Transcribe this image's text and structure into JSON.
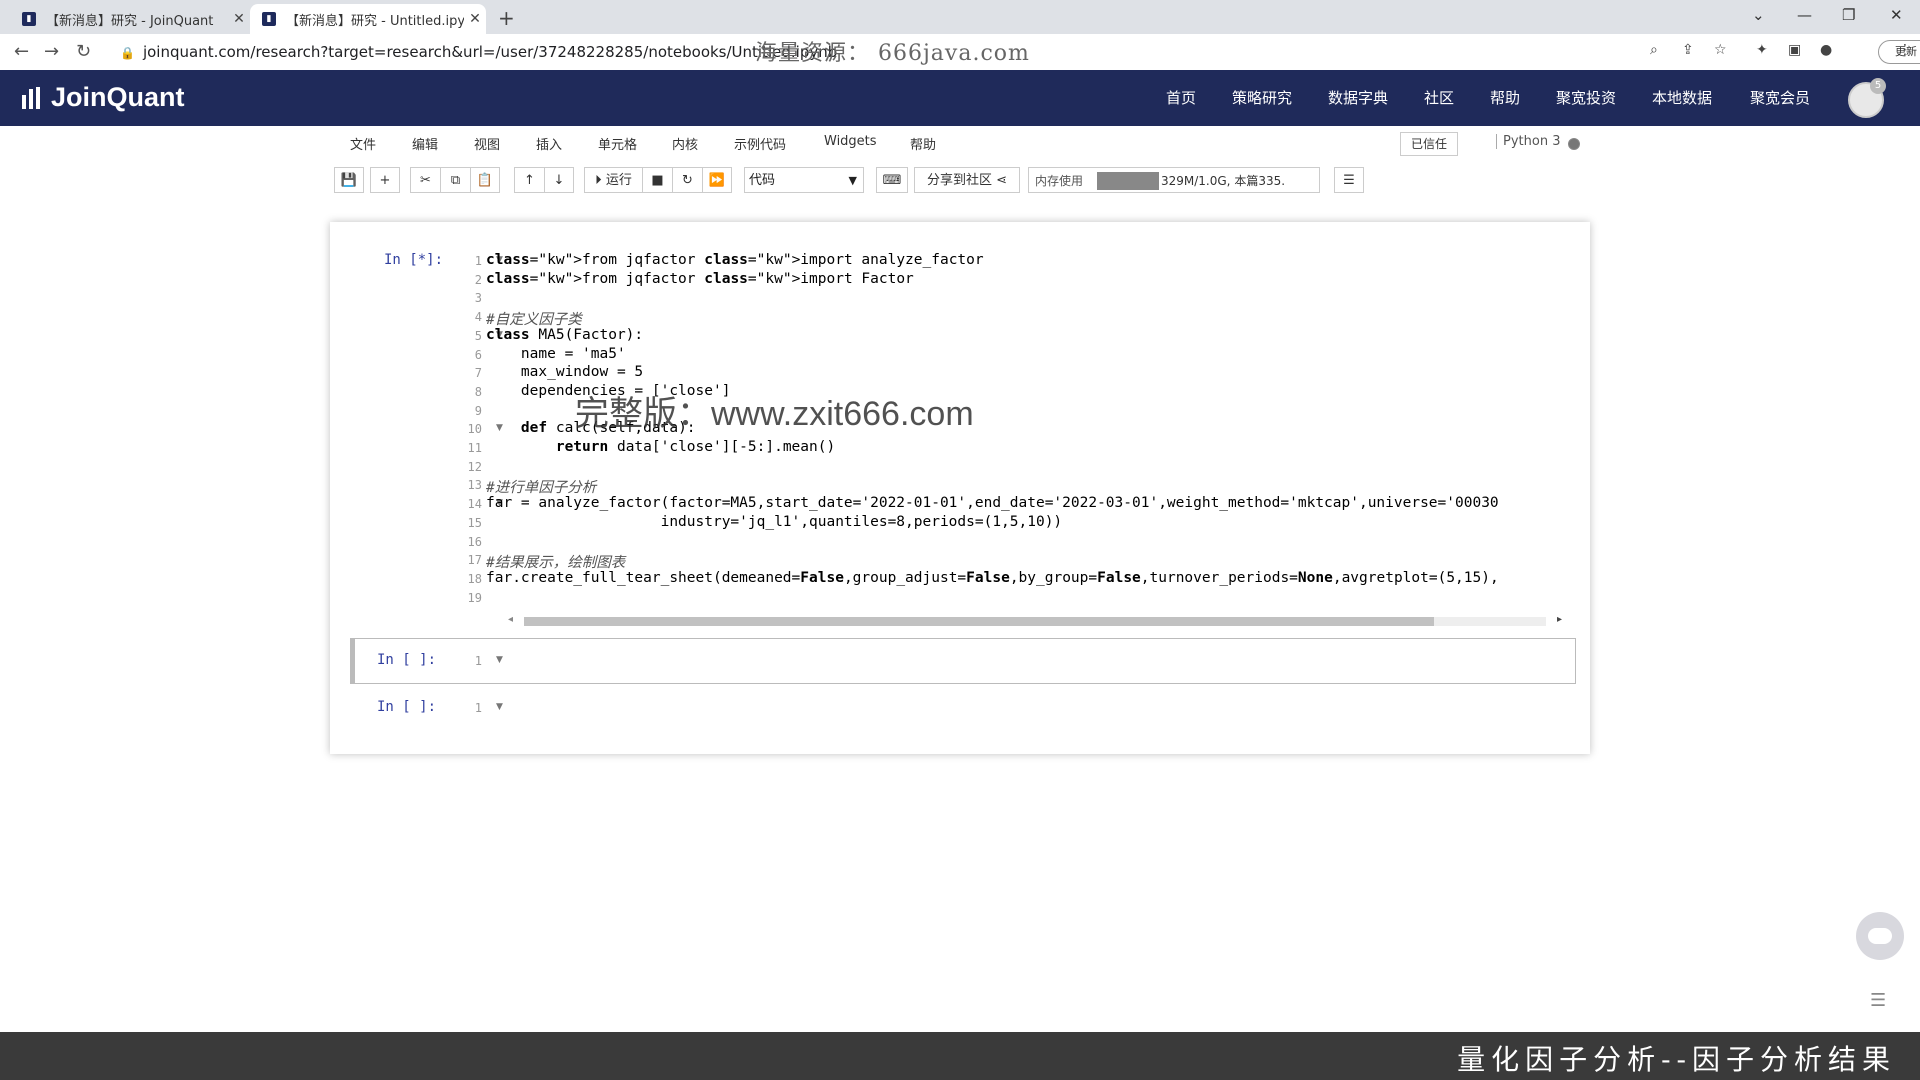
{
  "browser": {
    "tabs": [
      {
        "title": "【新消息】研究 - JoinQuant",
        "active": false
      },
      {
        "title": "【新消息】研究 - Untitled.ipyn",
        "active": true
      }
    ],
    "url": "joinquant.com/research?target=research&url=/user/37248228285/notebooks/Untitled.ipynb",
    "overlay_watermark": "海量资源： 666java.com",
    "update_label": "更新"
  },
  "header": {
    "logo": "JoinQuant",
    "nav": [
      "首页",
      "策略研究",
      "数据字典",
      "社区",
      "帮助",
      "聚宽投资",
      "本地数据",
      "聚宽会员"
    ],
    "notification_count": "5"
  },
  "jupyter_menu": {
    "items": [
      "文件",
      "编辑",
      "视图",
      "插入",
      "单元格",
      "内核",
      "示例代码",
      "Widgets",
      "帮助"
    ],
    "trusted": "已信任",
    "kernel": "Python 3"
  },
  "toolbar": {
    "run_label": "运行",
    "cell_type": "代码",
    "share_label": "分享到社区",
    "memory_label": "内存使用",
    "memory_value": "329M/1.0G, 本篇335."
  },
  "cells": [
    {
      "prompt": "In [*]:",
      "lines": [
        "from jqfactor import analyze_factor",
        "from jqfactor import Factor",
        "",
        "#自定义因子类",
        "class MA5(Factor):",
        "    name = 'ma5'",
        "    max_window = 5",
        "    dependencies = ['close']",
        "",
        "    def calc(self,data):",
        "        return data['close'][-5:].mean()",
        "",
        "#进行单因子分析",
        "far = analyze_factor(factor=MA5,start_date='2022-01-01',end_date='2022-03-01',weight_method='mktcap',universe='00030",
        "                    industry='jq_l1',quantiles=8,periods=(1,5,10))",
        "",
        "#结果展示，绘制图表",
        "far.create_full_tear_sheet(demeaned=False,group_adjust=False,by_group=False,turnover_periods=None,avgretplot=(5,15),",
        ""
      ]
    },
    {
      "prompt": "In [ ]:",
      "lines": [
        ""
      ]
    },
    {
      "prompt": "In [ ]:",
      "lines": [
        ""
      ]
    }
  ],
  "overlay": {
    "watermark": "完整版：www.zxit666.com",
    "caption": "量化因子分析--因子分析结果"
  }
}
